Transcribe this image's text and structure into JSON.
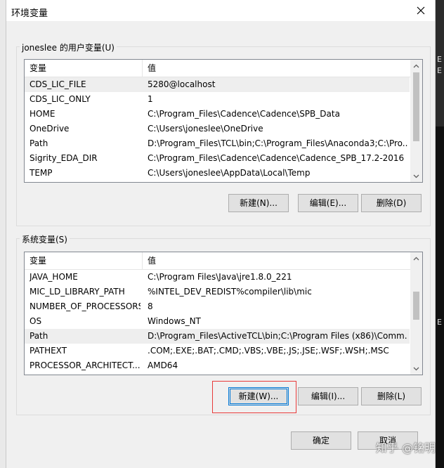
{
  "window": {
    "title": "环境变量"
  },
  "user_vars": {
    "group_label": "joneslee 的用户变量(U)",
    "columns": [
      "变量",
      "值"
    ],
    "rows": [
      {
        "name": "CDS_LIC_FILE",
        "value": "5280@localhost",
        "selected": true
      },
      {
        "name": "CDS_LIC_ONLY",
        "value": "1"
      },
      {
        "name": "HOME",
        "value": "C:\\Program_Files\\Cadence\\Cadence\\SPB_Data"
      },
      {
        "name": "OneDrive",
        "value": "C:\\Users\\joneslee\\OneDrive"
      },
      {
        "name": "Path",
        "value": "D:\\Program_Files\\TCL\\bin;C:\\Program_Files\\Anaconda3;C:\\Pro..."
      },
      {
        "name": "Sigrity_EDA_DIR",
        "value": "C:\\Program_Files\\Cadence\\Cadence\\Cadence_SPB_17.2-2016"
      },
      {
        "name": "TEMP",
        "value": "C:\\Users\\joneslee\\AppData\\Local\\Temp"
      }
    ],
    "buttons": {
      "new": "新建(N)...",
      "edit": "编辑(E)...",
      "delete": "删除(D)"
    }
  },
  "system_vars": {
    "group_label": "系统变量(S)",
    "columns": [
      "变量",
      "值"
    ],
    "rows": [
      {
        "name": "JAVA_HOME",
        "value": "C:\\Program Files\\Java\\jre1.8.0_221"
      },
      {
        "name": "MIC_LD_LIBRARY_PATH",
        "value": "%INTEL_DEV_REDIST%compiler\\lib\\mic"
      },
      {
        "name": "NUMBER_OF_PROCESSORS",
        "value": "8"
      },
      {
        "name": "OS",
        "value": "Windows_NT"
      },
      {
        "name": "Path",
        "value": "D:\\Program_Files\\ActiveTCL\\bin;C:\\Program Files (x86)\\Comm...",
        "selected": true
      },
      {
        "name": "PATHEXT",
        "value": ".COM;.EXE;.BAT;.CMD;.VBS;.VBE;.JS;.JSE;.WSF;.WSH;.MSC"
      },
      {
        "name": "PROCESSOR_ARCHITECT...",
        "value": "AMD64"
      }
    ],
    "buttons": {
      "new": "新建(W)...",
      "edit": "编辑(I)...",
      "delete": "删除(L)"
    }
  },
  "footer": {
    "ok": "确定",
    "cancel": "取消"
  },
  "watermark": "知乎 @铭明",
  "background_window": {
    "chars": [
      "E",
      "E",
      "E"
    ]
  },
  "colors": {
    "highlight_box": "#e83a3a",
    "focus_border": "#0078d7"
  }
}
